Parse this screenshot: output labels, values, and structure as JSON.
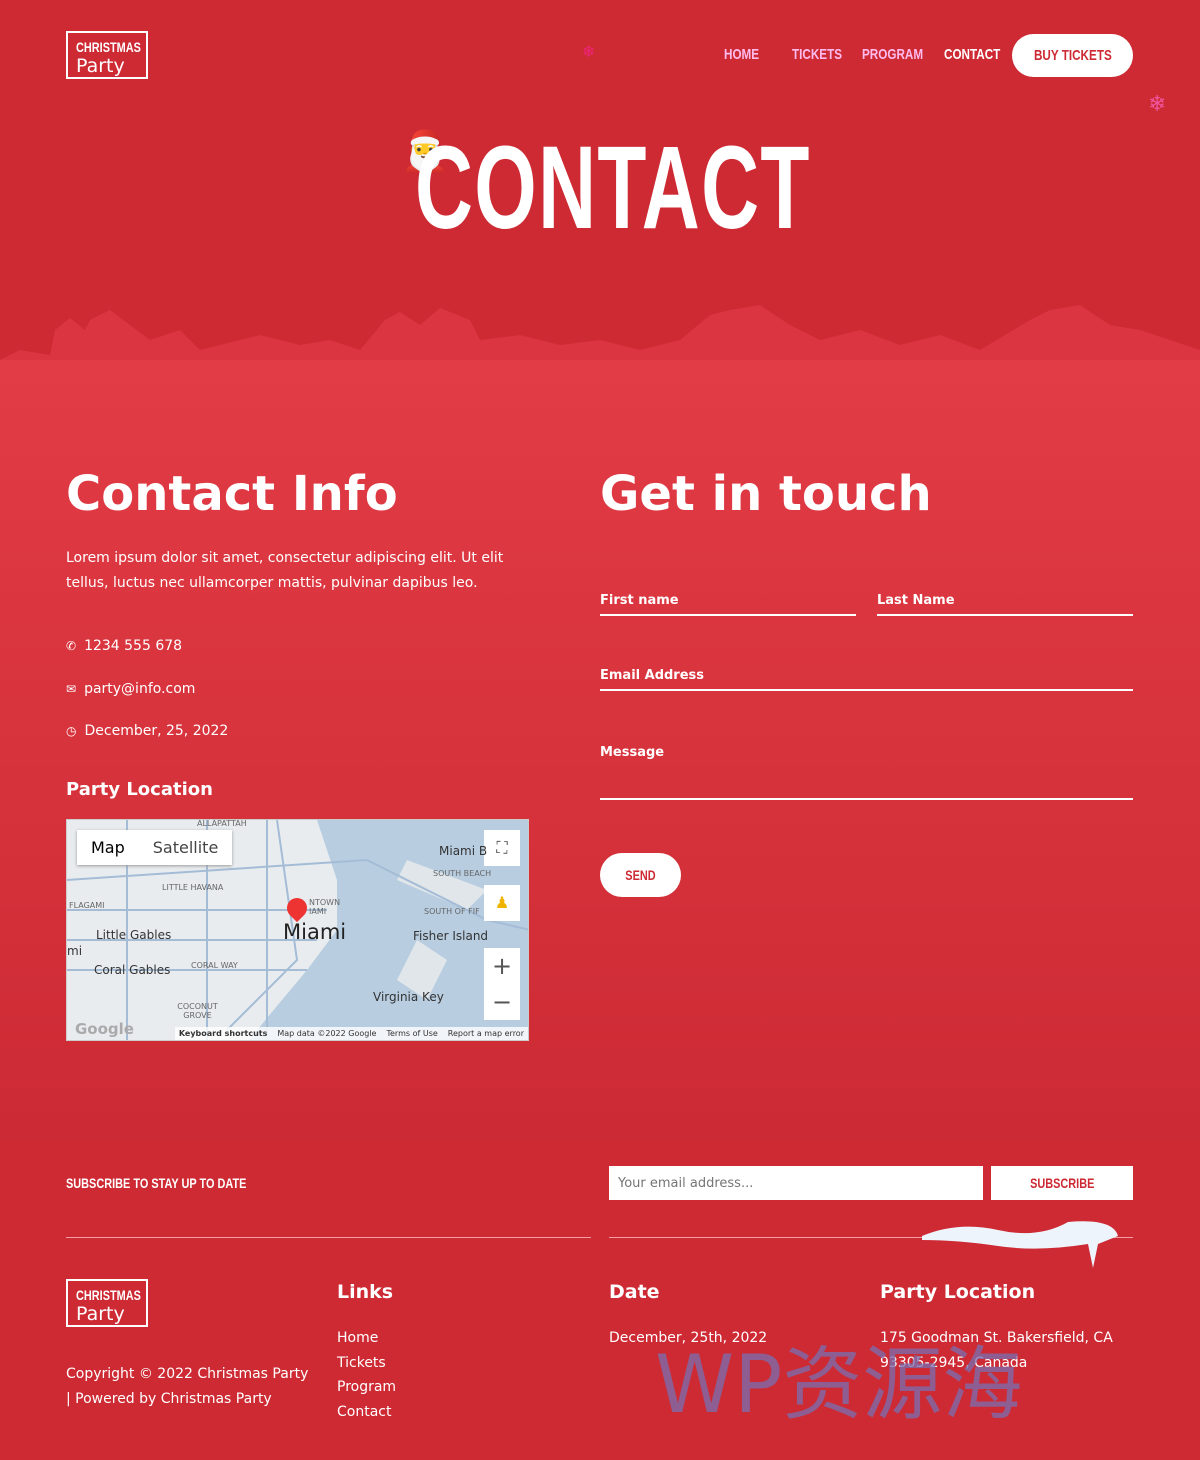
{
  "header": {
    "logo": {
      "line1": "CHRISTMAS",
      "line2": "Party"
    },
    "nav": [
      "HOME",
      "TICKETS",
      "PROGRAM",
      "CONTACT"
    ],
    "buy_tickets": "BUY TICKETS",
    "title": "CONTACT"
  },
  "contact_info": {
    "heading": "Contact Info",
    "description": "Lorem ipsum dolor sit amet, consectetur adipiscing elit. Ut elit tellus, luctus nec ullamcorper mattis, pulvinar dapibus leo.",
    "phone": "1234 555 678",
    "email": "party@info.com",
    "date": "December, 25, 2022",
    "location_heading": "Party Location"
  },
  "map": {
    "tabs": [
      "Map",
      "Satellite"
    ],
    "city": "Miami",
    "labels": [
      "ALLAPATTAH",
      "LITTLE HAVANA",
      "FLAGAMI",
      "Little Gables",
      "Coral Gables",
      "CORAL WAY",
      "COCONUT GROVE",
      "Fisher Island",
      "Virginia Key",
      "SOUTH BEACH",
      "Miami B",
      "SOUTH OF FIF",
      "NTOWN IAMI",
      "mi"
    ],
    "footer": [
      "Keyboard shortcuts",
      "Map data ©2022 Google",
      "Terms of Use",
      "Report a map error"
    ],
    "google": "Google"
  },
  "form": {
    "heading": "Get in touch",
    "first_name": "First name",
    "last_name": "Last Name",
    "email": "Email Address",
    "message": "Message",
    "send": "SEND"
  },
  "subscribe": {
    "label": "SUBSCRIBE TO STAY UP TO DATE",
    "placeholder": "Your email address...",
    "button": "SUBSCRIBE"
  },
  "footer": {
    "logo": {
      "line1": "CHRISTMAS",
      "line2": "Party"
    },
    "copyright": "Copyright © 2022 Christmas Party | Powered by Christmas Party",
    "links_heading": "Links",
    "links": [
      "Home",
      "Tickets",
      "Program",
      "Contact"
    ],
    "date_heading": "Date",
    "date": "December, 25th, 2022",
    "location_heading": "Party Location",
    "address1": "175 Goodman St. Bakersfield, CA",
    "address2": "93305-2945, Canada"
  },
  "watermark": "WP资源海",
  "colors": {
    "primary": "#cd2a34",
    "accent": "#e23c46"
  }
}
